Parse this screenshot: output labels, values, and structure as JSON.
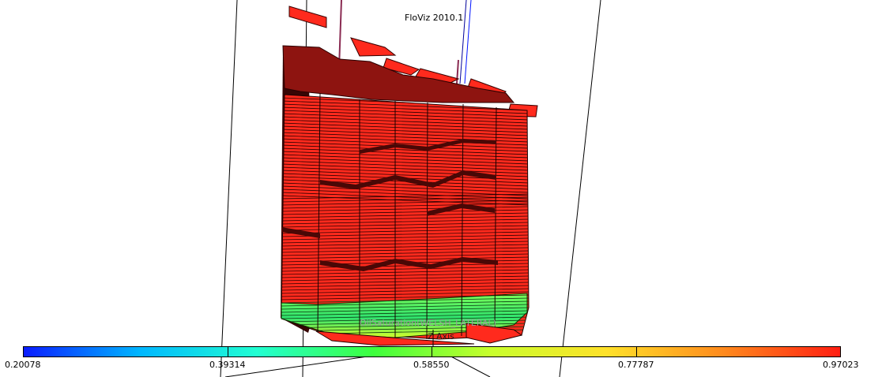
{
  "app": {
    "title": "FloViz 2010.1"
  },
  "viewer": {
    "property_label": "OilSaturation(WELSH_LATERAL)",
    "axis_label": "Z Axis"
  },
  "colorbar": {
    "colors": [
      "#0b1cff",
      "#00b7ff",
      "#22ffd2",
      "#3dff3d",
      "#c8ff2c",
      "#ffe12a",
      "#ff8a1d",
      "#ff1e12"
    ],
    "ticks": [
      "0.20078",
      "0.39314",
      "0.58550",
      "0.77787",
      "0.97023"
    ]
  },
  "scene": {
    "grid_color": "#ff2a1d",
    "shadow_color": "#7e0f0b",
    "gradient_bottom": [
      "#7dff58",
      "#2fe46f",
      "#d5ff2a"
    ]
  }
}
